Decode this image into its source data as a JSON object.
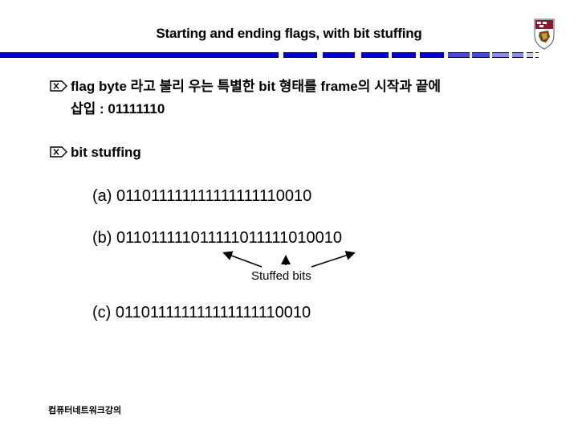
{
  "slide": {
    "title": "Starting and ending flags, with bit stuffing",
    "logo": "university-crest-logo",
    "bullets": [
      {
        "icon": "boxed-x-bullet-icon",
        "line1": "flag byte 라고 불리 우는 특별한 bit 형태를 frame의 시작과 끝에",
        "line2": "삽입 : 01111110"
      },
      {
        "icon": "boxed-x-bullet-icon",
        "line1": "bit stuffing"
      }
    ],
    "sequences": {
      "a": "(a) 011011111111111111110010",
      "b": "(b) 011011111011111011111010010",
      "c": "(c) 011011111111111111110010"
    },
    "annotation": "Stuffed bits",
    "footer": "컴퓨터네트워크강의",
    "colors": {
      "bar_dark": "#0000c8",
      "bar_mid": "#4a4ad8",
      "bar_light": "#8c8ce8",
      "bar_pale": "#c8c8f0"
    }
  }
}
